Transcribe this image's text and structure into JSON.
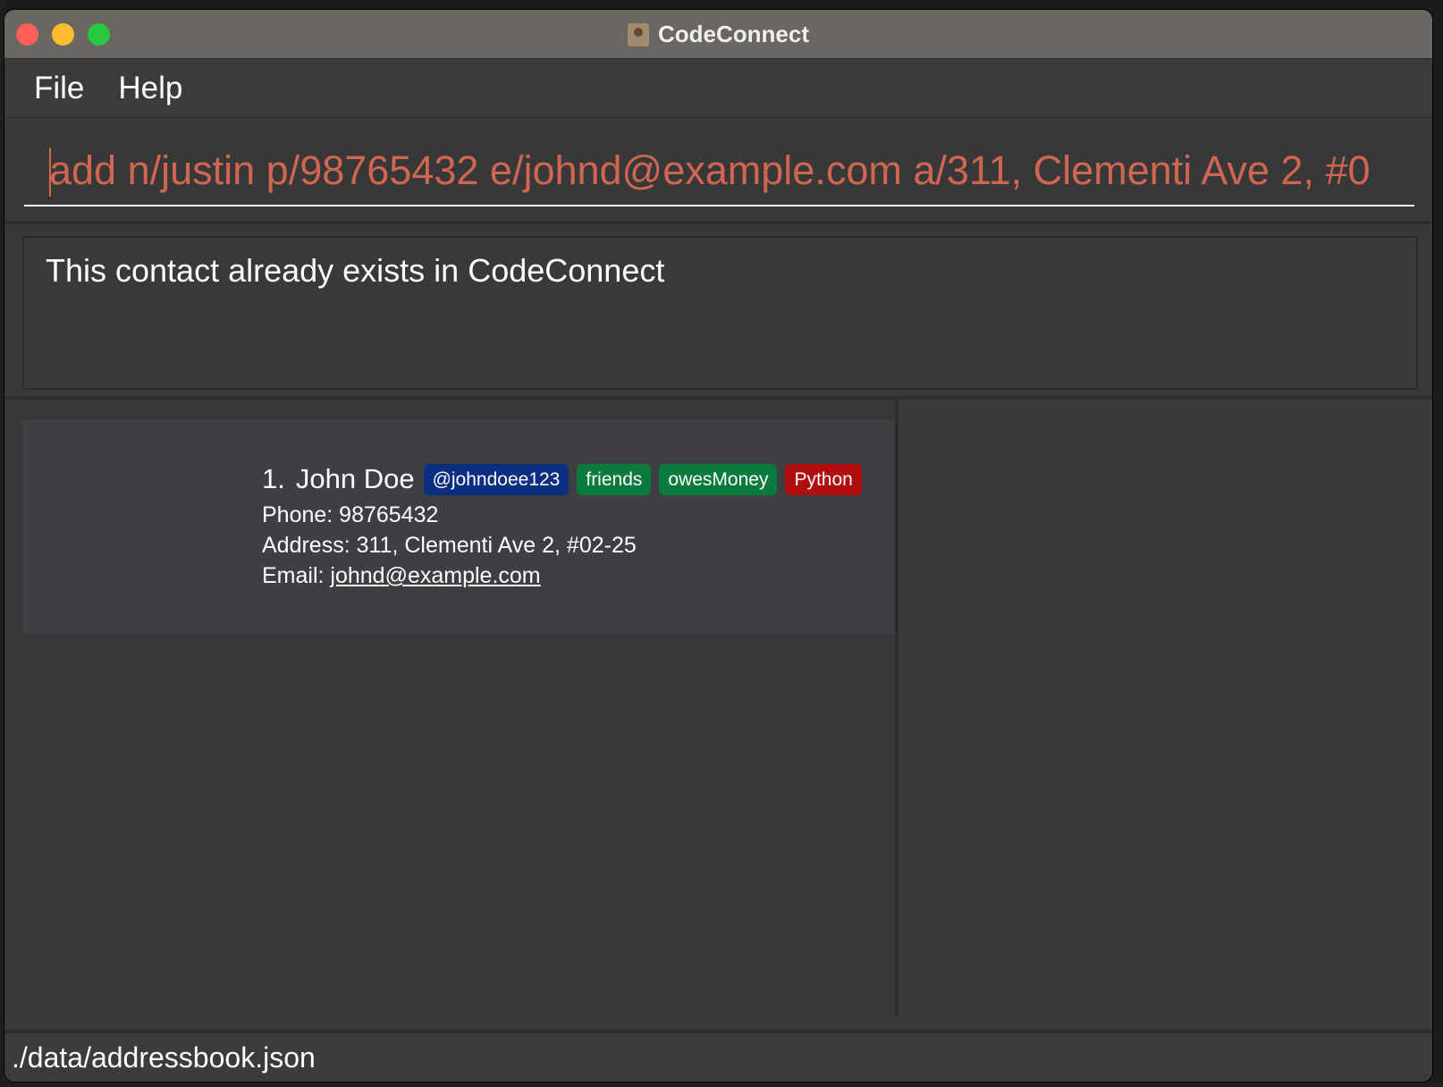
{
  "window": {
    "title": "CodeConnect"
  },
  "menu": {
    "items": [
      {
        "label": "File"
      },
      {
        "label": "Help"
      }
    ]
  },
  "command": {
    "value": "add n/justin p/98765432 e/johnd@example.com a/311, Clementi Ave 2, #0"
  },
  "result": {
    "message": "This contact already exists in CodeConnect"
  },
  "contacts": [
    {
      "index": "1.",
      "name": "John Doe",
      "tags": [
        {
          "label": "@johndoee123",
          "color": "#0b2d82"
        },
        {
          "label": "friends",
          "color": "#0b7a3f"
        },
        {
          "label": "owesMoney",
          "color": "#0b7a3f"
        },
        {
          "label": "Python",
          "color": "#b00e0e"
        }
      ],
      "phone": "Phone: 98765432",
      "address": "Address: 311, Clementi Ave 2, #02-25",
      "email_label": "Email: ",
      "email": "johnd@example.com"
    }
  ],
  "status": {
    "path": "./data/addressbook.json"
  },
  "colors": {
    "command_text": "#d06651",
    "background": "#3a3a3a"
  }
}
